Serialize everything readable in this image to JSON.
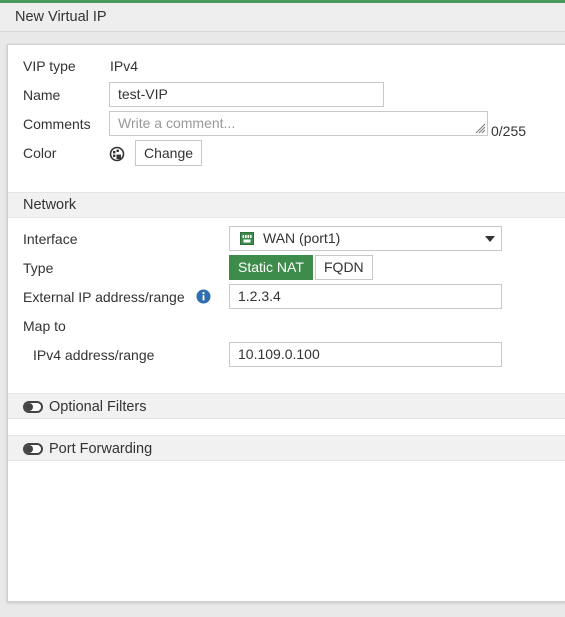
{
  "window": {
    "title": "New Virtual IP"
  },
  "general": {
    "vip_type_label": "VIP type",
    "vip_type_value": "IPv4",
    "name_label": "Name",
    "name_value": "test-VIP",
    "comments_label": "Comments",
    "comments_placeholder": "Write a comment...",
    "comments_counter": "0/255",
    "color_label": "Color",
    "color_change_button": "Change"
  },
  "network": {
    "section_title": "Network",
    "interface_label": "Interface",
    "interface_value": "WAN (port1)",
    "type_label": "Type",
    "type_options": [
      "Static NAT",
      "FQDN"
    ],
    "type_selected": "Static NAT",
    "external_ip_label": "External IP address/range",
    "external_ip_value": "1.2.3.4",
    "map_to_label": "Map to",
    "ipv4_range_label": "IPv4 address/range",
    "ipv4_range_value": "10.109.0.100"
  },
  "optional_filters": {
    "label": "Optional Filters",
    "enabled": false
  },
  "port_forwarding": {
    "label": "Port Forwarding",
    "enabled": false
  },
  "colors": {
    "accent_green": "#3d8c4c",
    "top_line": "#4a9a5a",
    "info_blue": "#2f6fb0"
  },
  "icons": {
    "color_icon": "palette-icon",
    "interface_icon": "network-port-icon",
    "info_icon": "info-icon",
    "dropdown_icon": "caret-down-icon"
  }
}
